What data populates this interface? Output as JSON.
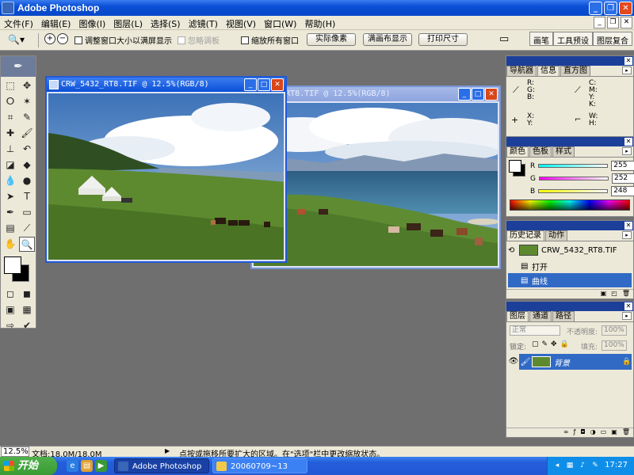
{
  "app": {
    "title": "Adobe Photoshop"
  },
  "window_buttons": {
    "minimize": "_",
    "restore": "❐",
    "close": "✕"
  },
  "menu": [
    "文件(F)",
    "编辑(E)",
    "图像(I)",
    "图层(L)",
    "选择(S)",
    "滤镜(T)",
    "视图(V)",
    "窗口(W)",
    "帮助(H)"
  ],
  "options_bar": {
    "tool": "zoom",
    "zoom_in": "+",
    "zoom_out": "−",
    "resize_windows_label": "调整窗口大小以满屏显示",
    "ignore_palettes_label": "忽略调板",
    "zoom_all_label": "缩放所有窗口",
    "actual_pixels_label": "实际像素",
    "fit_screen_label": "满画布显示",
    "print_size_label": "打印尺寸",
    "dock_tabs": [
      "画笔",
      "工具预设",
      "图层复合"
    ]
  },
  "documents": [
    {
      "title": "CRW_5432_RT8.TIF @ 12.5%(RGB/8)",
      "active": true
    },
    {
      "title": "CRW_5433_RT8.TIF @ 12.5%(RGB/8)",
      "visible_title": "433_RT8.TIF @ 12.5%(RGB/8)",
      "active": false
    }
  ],
  "navigator_panel": {
    "tabs": [
      "导航器",
      "信息",
      "直方图"
    ],
    "active_tab": "信息",
    "rgb_labels": [
      "R:",
      "G:",
      "B:"
    ],
    "cmyk_labels": [
      "C:",
      "M:",
      "Y:",
      "K:"
    ],
    "xy_labels": [
      "X:",
      "Y:"
    ],
    "wh_labels": [
      "W:",
      "H:"
    ]
  },
  "color_panel": {
    "tabs": [
      "颜色",
      "色板",
      "样式"
    ],
    "active_tab": "颜色",
    "channels": [
      {
        "label": "R",
        "value": "255"
      },
      {
        "label": "G",
        "value": "252"
      },
      {
        "label": "B",
        "value": "248"
      }
    ]
  },
  "history_panel": {
    "tabs": [
      "历史记录",
      "动作"
    ],
    "active_tab": "历史记录",
    "snapshot": "CRW_5432_RT8.TIF",
    "states": [
      {
        "label": "打开",
        "selected": false
      },
      {
        "label": "曲线",
        "selected": true
      }
    ]
  },
  "layers_panel": {
    "tabs": [
      "图层",
      "通道",
      "路径"
    ],
    "active_tab": "图层",
    "blend_mode": "正常",
    "opacity_label": "不透明度:",
    "opacity_value": "100%",
    "lock_label": "锁定:",
    "fill_label": "填充:",
    "fill_value": "100%",
    "layers": [
      {
        "name": "背景",
        "visible": true,
        "locked": true
      }
    ]
  },
  "status_bar": {
    "zoom": "12.5%",
    "doc_size": "文档:18.0M/18.0M",
    "message": "点按或拖移所要扩大的区域。在\"选项\"栏中更改缩放状态。"
  },
  "taskbar": {
    "start_label": "开始",
    "items": [
      {
        "label": "Adobe Photoshop",
        "active": true
      },
      {
        "label": "20060709~13",
        "active": false
      }
    ],
    "clock": "17:27"
  },
  "colors": {
    "title_bar": "#0a4fd6",
    "taskbar": "#245edb",
    "workspace": "#6f6f6f",
    "panel_bg": "#ece9d8",
    "history_selected": "#316ac5"
  }
}
